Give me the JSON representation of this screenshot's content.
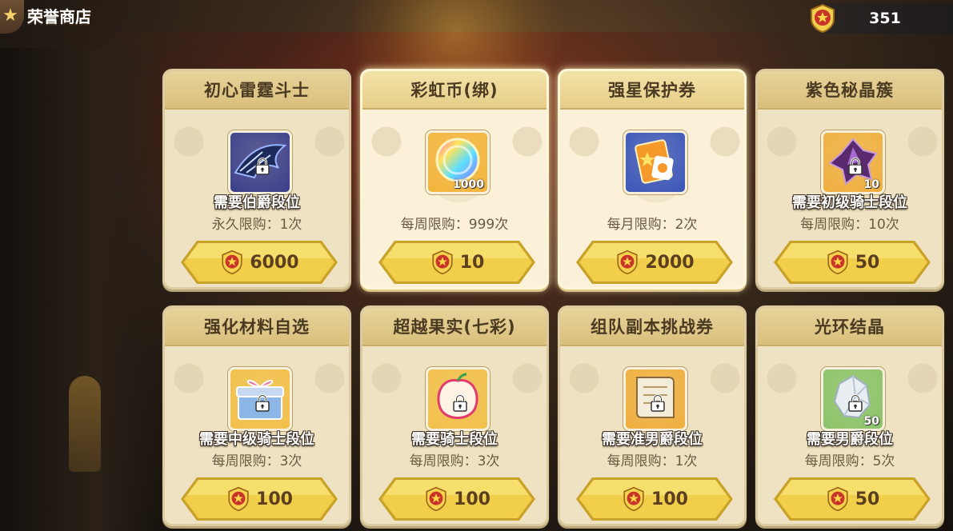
{
  "header": {
    "back_icon": "star-back-icon",
    "title": "荣誉商店",
    "currency_icon": "honor-medal-icon",
    "currency_amount": "351"
  },
  "colors": {
    "accent_gold": "#f1cf4a",
    "button_text": "#5b3f1e",
    "card_bg": "#efe2c2",
    "header_bg": "#d9bf7c"
  },
  "items": [
    {
      "name": "初心雷霆斗士",
      "icon": "thunder-wings-icon",
      "locked": true,
      "qty": "",
      "requirement": "需要伯爵段位",
      "limit": "永久限购：1次",
      "price": "6000",
      "active": false,
      "box_color": "#3b3f8a"
    },
    {
      "name": "彩虹币(绑)",
      "icon": "rainbow-coin-icon",
      "locked": false,
      "qty": "1000",
      "requirement": "",
      "limit": "每周限购：999次",
      "price": "10",
      "active": true,
      "box_color": "#f3b43a"
    },
    {
      "name": "强星保护券",
      "icon": "star-protect-ticket-icon",
      "locked": false,
      "qty": "",
      "requirement": "",
      "limit": "每月限购：2次",
      "price": "2000",
      "active": true,
      "box_color": "#3b56b8"
    },
    {
      "name": "紫色秘晶簇",
      "icon": "purple-crystal-icon",
      "locked": true,
      "qty": "10",
      "requirement": "需要初级骑士段位",
      "limit": "每周限购：10次",
      "price": "50",
      "active": false,
      "box_color": "#f0b040"
    },
    {
      "name": "强化材料自选",
      "icon": "gift-box-icon",
      "locked": true,
      "qty": "",
      "requirement": "需要中级骑士段位",
      "limit": "每周限购：3次",
      "price": "100",
      "active": false,
      "box_color": "#f2c04a"
    },
    {
      "name": "超越果实(七彩)",
      "icon": "rainbow-fruit-icon",
      "locked": true,
      "qty": "",
      "requirement": "需要骑士段位",
      "limit": "每周限购：3次",
      "price": "100",
      "active": false,
      "box_color": "#f2c04a"
    },
    {
      "name": "组队副本挑战券",
      "icon": "scroll-ticket-icon",
      "locked": true,
      "qty": "",
      "requirement": "需要准男爵段位",
      "limit": "每周限购：1次",
      "price": "100",
      "active": false,
      "box_color": "#f0b040"
    },
    {
      "name": "光环结晶",
      "icon": "halo-crystal-icon",
      "locked": true,
      "qty": "50",
      "requirement": "需要男爵段位",
      "limit": "每周限购：5次",
      "price": "50",
      "active": false,
      "box_color": "#8bc46a"
    }
  ]
}
